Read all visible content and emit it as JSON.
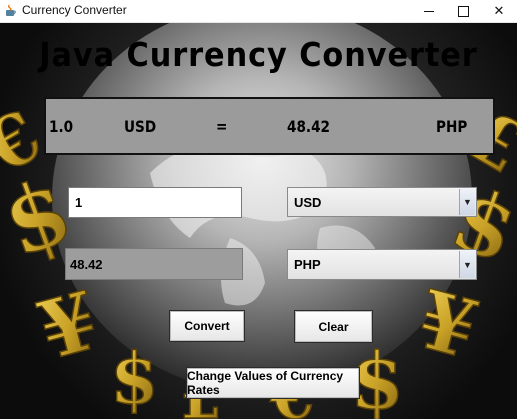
{
  "window": {
    "title": "Currency Converter",
    "controls": {
      "minimize": "—",
      "maximize": "□",
      "close": "✕"
    }
  },
  "app": {
    "heading": "Java Currency Converter"
  },
  "result": {
    "amount": "1.0",
    "from_currency": "USD",
    "equals": "=",
    "converted_value": "48.42",
    "to_currency": "PHP"
  },
  "form": {
    "amount_value": "1",
    "from_select": {
      "selected": "USD"
    },
    "output_value": "48.42",
    "to_select": {
      "selected": "PHP"
    }
  },
  "buttons": {
    "convert": "Convert",
    "clear": "Clear",
    "change_rates": "Change Values of Currency Rates"
  },
  "colors": {
    "accent_gold": "#c9a227",
    "panel_gray": "#9b9b9b"
  },
  "icons": {
    "app": "java-cup-icon",
    "dropdown": "triangle-down-icon"
  }
}
